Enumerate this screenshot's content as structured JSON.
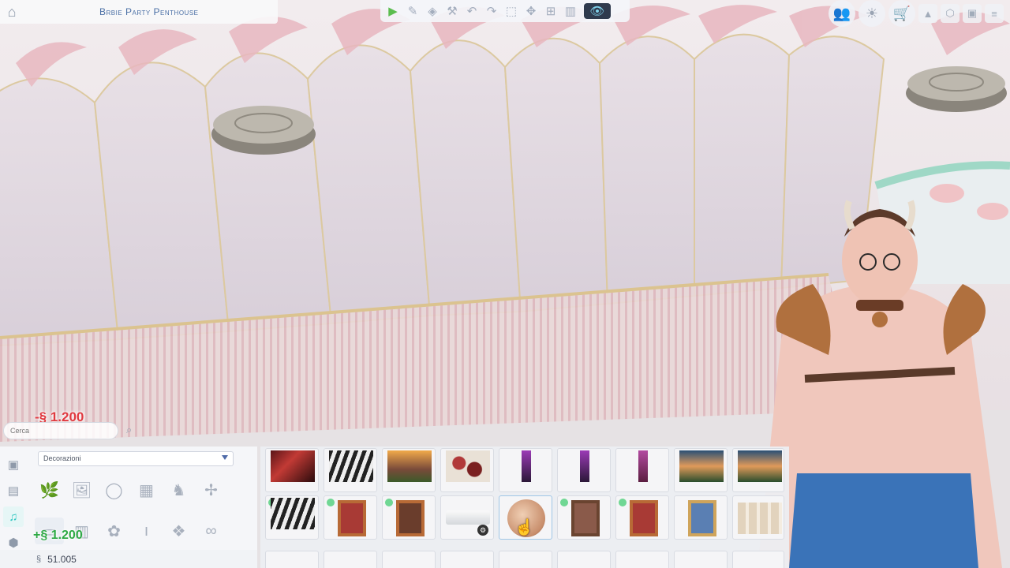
{
  "hud": {
    "lot_name": "Brbie Party Penthouse",
    "home_icon": "home-icon"
  },
  "toolbar": {
    "tools": [
      {
        "name": "select-tool",
        "glyph": "▶"
      },
      {
        "name": "eyedropper-tool",
        "glyph": "✎"
      },
      {
        "name": "design-tool",
        "glyph": "◈"
      },
      {
        "name": "sledgehammer-tool",
        "glyph": "⚒"
      },
      {
        "name": "undo-tool",
        "glyph": "↶"
      },
      {
        "name": "redo-tool",
        "glyph": "↷"
      },
      {
        "name": "place-tool",
        "glyph": "⬚"
      },
      {
        "name": "move-tool",
        "glyph": "✥"
      },
      {
        "name": "floor-up-tool",
        "glyph": "⊞"
      },
      {
        "name": "wall-tool",
        "glyph": "▥"
      }
    ],
    "camera_icon": "👁"
  },
  "topright": {
    "icons": [
      {
        "name": "sims-icon",
        "glyph": "👥"
      },
      {
        "name": "lightbulb-icon",
        "glyph": "☀"
      },
      {
        "name": "cart-icon",
        "glyph": "🛒"
      }
    ],
    "small": [
      {
        "name": "floor-up-icon",
        "glyph": "▲"
      },
      {
        "name": "cube-icon",
        "glyph": "⬡"
      },
      {
        "name": "window-icon",
        "glyph": "▣"
      },
      {
        "name": "menu-icon",
        "glyph": "≡"
      }
    ]
  },
  "catalog": {
    "cost": "-§ 1.200",
    "search_placeholder": "Cerca",
    "category": "Decorazioni",
    "gain": "+§ 1.200",
    "funds": "51.005",
    "funds_symbol": "§"
  }
}
